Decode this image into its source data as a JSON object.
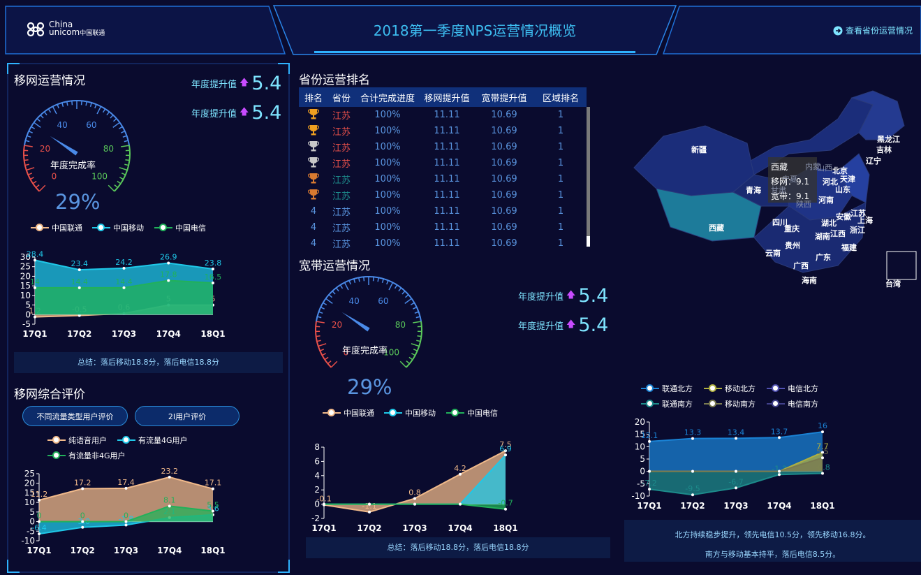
{
  "header": {
    "logo_en": "China unicom",
    "logo_cn": "中国联通",
    "title": "2018第一季度NPS运营情况概览",
    "link": "查看省份运营情况"
  },
  "mobile_ops": {
    "title": "移网运营情况",
    "up1_label": "年度提升值",
    "up1_value": "5.4",
    "up2_label": "年度提升值",
    "up2_value": "5.4",
    "gauge_label": "年度完成率",
    "gauge_percent": "29%",
    "gauge_value": 29,
    "gauge_ticks": [
      "0",
      "20",
      "40",
      "60",
      "80",
      "100"
    ],
    "legend": [
      "中国联通",
      "中国移动",
      "中国电信"
    ],
    "summary": "总结：落后移动18.8分，落后电信18.8分"
  },
  "mobile_eval": {
    "title": "移网综合评价",
    "btn1": "不同流量类型用户评价",
    "btn2": "2I用户评价",
    "legend": [
      "纯语音用户",
      "有流量4G用户",
      "有流量非4G用户"
    ]
  },
  "ranking": {
    "title": "省份运营排名",
    "columns": [
      "排名",
      "省份",
      "合计完成进度",
      "移网提升值",
      "宽带提升值",
      "区域排名"
    ],
    "rows": [
      {
        "rank": "gold",
        "province": "江苏",
        "progress": "100%",
        "mobile": "11.11",
        "broadband": "10.69",
        "region": "1"
      },
      {
        "rank": "gold",
        "province": "江苏",
        "progress": "100%",
        "mobile": "11.11",
        "broadband": "10.69",
        "region": "1"
      },
      {
        "rank": "silver",
        "province": "江苏",
        "progress": "100%",
        "mobile": "11.11",
        "broadband": "10.69",
        "region": "1"
      },
      {
        "rank": "silver",
        "province": "江苏",
        "progress": "100%",
        "mobile": "11.11",
        "broadband": "10.69",
        "region": "1"
      },
      {
        "rank": "bronze",
        "province": "江苏",
        "progress": "100%",
        "mobile": "11.11",
        "broadband": "10.69",
        "region": "1"
      },
      {
        "rank": "bronze",
        "province": "江苏",
        "progress": "100%",
        "mobile": "11.11",
        "broadband": "10.69",
        "region": "1"
      },
      {
        "rank": "4",
        "province": "江苏",
        "progress": "100%",
        "mobile": "11.11",
        "broadband": "10.69",
        "region": "1"
      },
      {
        "rank": "4",
        "province": "江苏",
        "progress": "100%",
        "mobile": "11.11",
        "broadband": "10.69",
        "region": "1"
      },
      {
        "rank": "4",
        "province": "江苏",
        "progress": "100%",
        "mobile": "11.11",
        "broadband": "10.69",
        "region": "1"
      }
    ]
  },
  "broadband_ops": {
    "title": "宽带运营情况",
    "up1_label": "年度提升值",
    "up1_value": "5.4",
    "up2_label": "年度提升值",
    "up2_value": "5.4",
    "gauge_label": "年度完成率",
    "gauge_percent": "29%",
    "gauge_value": 29,
    "gauge_ticks": [
      "0",
      "20",
      "40",
      "60",
      "80",
      "100"
    ],
    "legend": [
      "中国联通",
      "中国移动",
      "中国电信"
    ],
    "summary": "总结：落后移动18.8分，落后电信18.8分"
  },
  "map": {
    "tooltip_title": "西藏",
    "tooltip_line1": "移网：9.1",
    "tooltip_line2": "宽带：9.1",
    "labels": [
      "黑龙江",
      "吉林",
      "辽宁",
      "新疆",
      "北京",
      "天津",
      "河北",
      "山东",
      "青海",
      "河南",
      "江苏",
      "上海",
      "安徽",
      "湖北",
      "浙江",
      "西藏",
      "四川",
      "重庆",
      "湖南",
      "江西",
      "贵州",
      "云南",
      "广西",
      "广东",
      "福建",
      "海南",
      "内蒙",
      "宁夏",
      "甘肃",
      "陕西",
      "山西",
      "台湾"
    ]
  },
  "region": {
    "legend": [
      "联通北方",
      "移动北方",
      "电信北方",
      "联通南方",
      "移动南方",
      "电信南方"
    ],
    "summary1": "北方持续稳步提升，领先电信10.5分，领先移动16.8分。",
    "summary2": "南方与移动基本持平，落后电信8.5分。"
  },
  "chart_data": [
    {
      "id": "mobile_ops_chart",
      "type": "area",
      "categories": [
        "17Q1",
        "17Q2",
        "17Q3",
        "17Q4",
        "18Q1"
      ],
      "ylim": [
        -5,
        30
      ],
      "yticks": [
        -5,
        0,
        5,
        10,
        15,
        20,
        25,
        30
      ],
      "series": [
        {
          "name": "中国联通",
          "color": "#f0b98a",
          "values": [
            -1.2,
            -0.5,
            0.6,
            5,
            5
          ]
        },
        {
          "name": "中国移动",
          "color": "#1fc8e8",
          "values": [
            28.4,
            23.4,
            24.2,
            26.9,
            23.8
          ]
        },
        {
          "name": "中国电信",
          "color": "#21b15a",
          "values": [
            14,
            14,
            14,
            17.8,
            16.5
          ]
        }
      ],
      "labels": {
        "中国联通": [
          "1.2",
          "-0.5",
          "0.6",
          "5",
          "5"
        ],
        "中国移动": [
          "28.4",
          "23.4",
          "24.2",
          "26.9",
          "23.8"
        ],
        "中国电信": [
          "14",
          "14.4",
          "14.4",
          "17.8",
          "16.5"
        ]
      }
    },
    {
      "id": "mobile_eval_chart",
      "type": "area",
      "categories": [
        "17Q1",
        "17Q2",
        "17Q3",
        "17Q4",
        "18Q1"
      ],
      "ylim": [
        -10,
        25
      ],
      "yticks": [
        -10,
        -5,
        0,
        5,
        10,
        15,
        20,
        25
      ],
      "series": [
        {
          "name": "纯语音用户",
          "color": "#f0b98a",
          "values": [
            11.2,
            17.2,
            17.4,
            23.2,
            17.1
          ]
        },
        {
          "name": "有流量4G用户",
          "color": "#1fc8e8",
          "values": [
            -6.4,
            -3,
            -1.8,
            2.1,
            3.6
          ]
        },
        {
          "name": "有流量非4G用户",
          "color": "#21b15a",
          "values": [
            0,
            0,
            0,
            8.1,
            5.5
          ]
        }
      ],
      "labels": {
        "纯语音用户": [
          "11.2",
          "17.2",
          "17.4",
          "23.2",
          "17.1"
        ],
        "有流量4G用户": [
          "-6.4",
          "-3.0",
          "-1.8",
          "2.1",
          "3.6"
        ],
        "有流量非4G用户": [
          "0",
          "0",
          "0",
          "8.1",
          "5.5"
        ]
      }
    },
    {
      "id": "broadband_chart",
      "type": "area",
      "categories": [
        "17Q1",
        "17Q2",
        "17Q3",
        "17Q4",
        "18Q1"
      ],
      "ylim": [
        -2,
        8
      ],
      "yticks": [
        -2,
        0,
        2,
        4,
        6,
        8
      ],
      "series": [
        {
          "name": "中国联通",
          "color": "#f0b98a",
          "values": [
            -0.1,
            -1.1,
            0.8,
            4.2,
            7.5
          ]
        },
        {
          "name": "中国移动",
          "color": "#1fc8e8",
          "values": [
            0,
            0,
            0,
            0,
            6.9
          ]
        },
        {
          "name": "中国电信",
          "color": "#21b15a",
          "values": [
            0,
            0,
            0,
            0,
            -0.7
          ]
        }
      ],
      "labels": {
        "中国联通": [
          "-0.1",
          "-1.1",
          "0.8",
          "4.2",
          "7.5"
        ],
        "中国移动": [
          "",
          "",
          "",
          "",
          "6.9"
        ],
        "中国电信": [
          "",
          "",
          "",
          "",
          "-0.7"
        ]
      }
    },
    {
      "id": "region_chart",
      "type": "area",
      "categories": [
        "17Q1",
        "17Q2",
        "17Q3",
        "17Q4",
        "18Q1"
      ],
      "ylim": [
        -10,
        20
      ],
      "yticks": [
        -10,
        -5,
        0,
        5,
        10,
        15,
        20
      ],
      "series": [
        {
          "name": "联通北方",
          "color": "#1a82d4",
          "values": [
            12.1,
            13.3,
            13.4,
            13.7,
            16
          ]
        },
        {
          "name": "联通南方",
          "color": "#1d8b8b",
          "values": [
            -7.2,
            -9.5,
            -6.7,
            -1.3,
            -0.8
          ]
        },
        {
          "name": "移动北方",
          "color": "#b0b040",
          "values": [
            0,
            0,
            0,
            0,
            7.7
          ]
        },
        {
          "name": "移动南方",
          "color": "#7a7a50",
          "values": [
            0,
            0,
            0,
            0,
            5.5
          ]
        }
      ],
      "labels": {
        "联通北方": [
          "12.1",
          "13.3",
          "13.4",
          "13.7",
          "16"
        ],
        "联通南方": [
          "-7.2",
          "-9.5",
          "-6.7",
          "-1.3",
          "-0.8"
        ],
        "移动北方": [
          "",
          "",
          "",
          "",
          "7.7"
        ],
        "移动南方": [
          "",
          "",
          "",
          "",
          "5.5"
        ]
      }
    }
  ]
}
